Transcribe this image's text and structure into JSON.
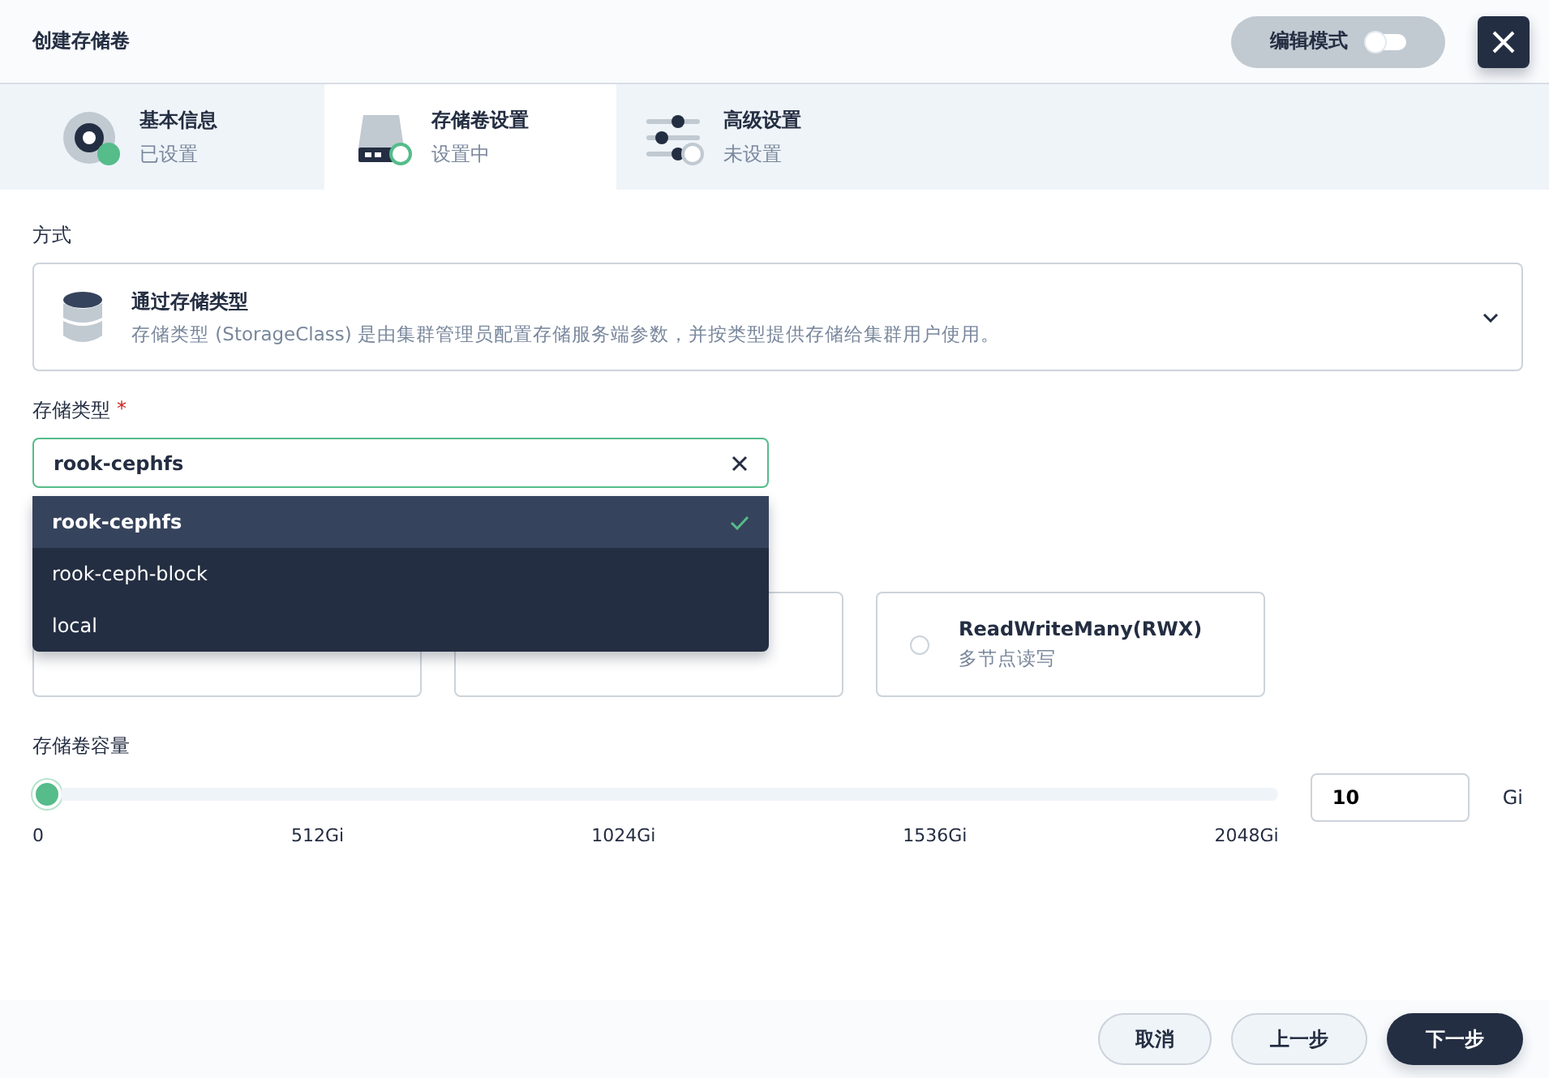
{
  "header": {
    "title": "创建存储卷",
    "edit_mode": {
      "label": "编辑模式",
      "on": false
    }
  },
  "steps": [
    {
      "title": "基本信息",
      "status_text": "已设置",
      "kind": "disc",
      "completed": true,
      "selected": false
    },
    {
      "title": "存储卷设置",
      "status_text": "设置中",
      "kind": "drive",
      "completed": false,
      "selected": true
    },
    {
      "title": "高级设置",
      "status_text": "未设置",
      "kind": "sliders",
      "completed": false,
      "selected": false
    }
  ],
  "method": {
    "label": "方式",
    "title": "通过存储类型",
    "description": "存储类型 (StorageClass) 是由集群管理员配置存储服务端参数，并按类型提供存储给集群用户使用。"
  },
  "storage_class": {
    "label": "存储类型",
    "required_mark": "*",
    "value": "rook-cephfs",
    "expanded": true,
    "options": [
      {
        "label": "rook-cephfs",
        "selected": true
      },
      {
        "label": "rook-ceph-block",
        "selected": false
      },
      {
        "label": "local",
        "selected": false
      }
    ]
  },
  "access_modes": [
    {
      "kind": "covered"
    },
    {
      "kind": "covered"
    },
    {
      "kind": "option",
      "title": "ReadWriteMany(RWX)",
      "description": "多节点读写",
      "selected": false
    }
  ],
  "capacity": {
    "label": "存储卷容量",
    "level": 0,
    "ticks": [
      "0",
      "512Gi",
      "1024Gi",
      "1536Gi",
      "2048Gi"
    ],
    "value": "10",
    "unit": "Gi"
  },
  "footer": {
    "buttons": [
      {
        "label": "取消",
        "kind": "secondary"
      },
      {
        "label": "上一步",
        "kind": "secondary"
      },
      {
        "label": "下一步",
        "kind": "primary"
      }
    ]
  }
}
